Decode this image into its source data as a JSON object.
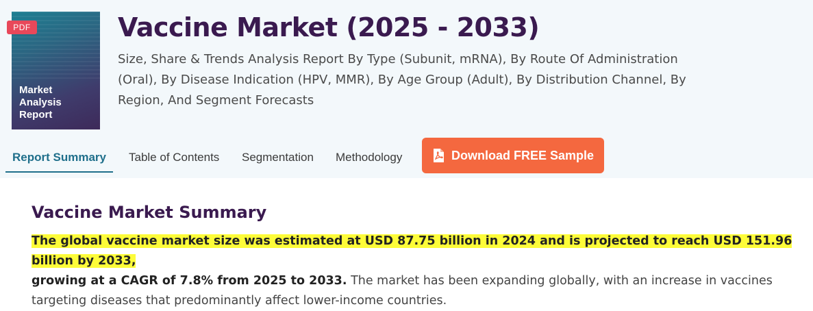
{
  "cover": {
    "pdf_tag": "PDF",
    "line1": "Market",
    "line2": "Analysis",
    "line3": "Report",
    "colors": {
      "top": "#1d7f92",
      "bottom": "#3e2a5a"
    }
  },
  "header": {
    "title": "Vaccine Market (2025 - 2033)",
    "subtitle": "Size, Share & Trends Analysis Report By Type (Subunit, mRNA), By Route Of Administration (Oral), By Disease Indication (HPV, MMR), By Age Group (Adult), By Distribution Channel, By Region, And Segment Forecasts"
  },
  "tabs": [
    {
      "label": "Report Summary",
      "active": true
    },
    {
      "label": "Table of Contents",
      "active": false
    },
    {
      "label": "Segmentation",
      "active": false
    },
    {
      "label": "Methodology",
      "active": false
    }
  ],
  "download": {
    "label": "Download FREE Sample",
    "icon": "pdf-file-icon",
    "color": "#f4683f"
  },
  "summary": {
    "title": "Vaccine Market Summary",
    "highlight": "The global vaccine market size was estimated at USD 87.75 billion in 2024 and is projected to reach USD 151.96 billion by 2033,",
    "bold_rest": "growing at a CAGR of 7.8% from 2025 to 2033.",
    "plain": " The market has been expanding globally, with an increase in vaccines targeting diseases that predominantly affect lower-income countries."
  }
}
